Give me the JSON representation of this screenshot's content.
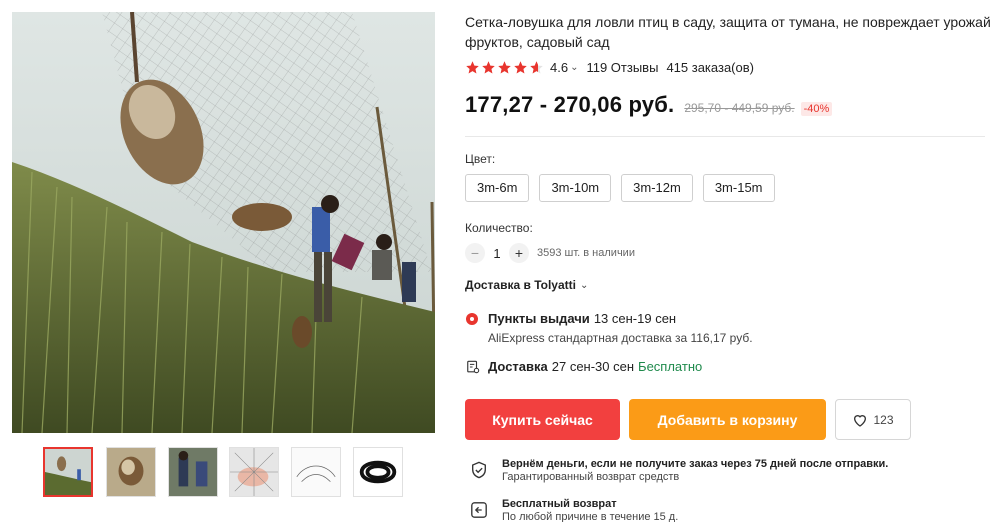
{
  "product": {
    "title": "Сетка-ловушка для ловли птиц в саду, защита от тумана, не повреждает урожай фруктов, садовый сад",
    "rating": "4.6",
    "rating_stars": 4.6,
    "reviews": "119 Отзывы",
    "orders": "415 заказа(ов)",
    "price": "177,27 - 270,06 руб.",
    "old_price": "295,70 - 449,59 руб.",
    "discount": "-40%"
  },
  "gallery": {
    "thumbnails": [
      "net-field-thumb",
      "bird-thumb",
      "people-thumb",
      "hand-net-thumb",
      "net-white-thumb",
      "net-bundle-thumb"
    ],
    "active_index": 0
  },
  "color": {
    "label": "Цвет:",
    "options": [
      "3m-6m",
      "3m-10m",
      "3m-12m",
      "3m-15m"
    ]
  },
  "quantity": {
    "label": "Количество:",
    "minus": "−",
    "value": "1",
    "plus": "+",
    "stock": "3593 шт. в наличии"
  },
  "delivery": {
    "to_label": "Доставка в Tolyatti",
    "pickup_title": "Пункты выдачи",
    "pickup_dates": "13 сен-19 сен",
    "pickup_detail": "AliExpress стандартная доставка за 116,17 руб.",
    "ship_title": "Доставка",
    "ship_dates": "27 сен-30 сен",
    "ship_free": "Бесплатно"
  },
  "actions": {
    "buy": "Купить сейчас",
    "cart": "Добавить в корзину",
    "wishlist_count": "123"
  },
  "guarantees": {
    "refund_title": "Вернём деньги, если не получите заказ через 75 дней после отправки.",
    "refund_sub": "Гарантированный возврат средств",
    "return_title": "Бесплатный возврат",
    "return_sub": "По любой причине в течение 15 д."
  },
  "colors": {
    "accent_red": "#f2403f",
    "accent_orange": "#fb9b17",
    "star": "#e8352e",
    "free_green": "#1f8a4c"
  }
}
